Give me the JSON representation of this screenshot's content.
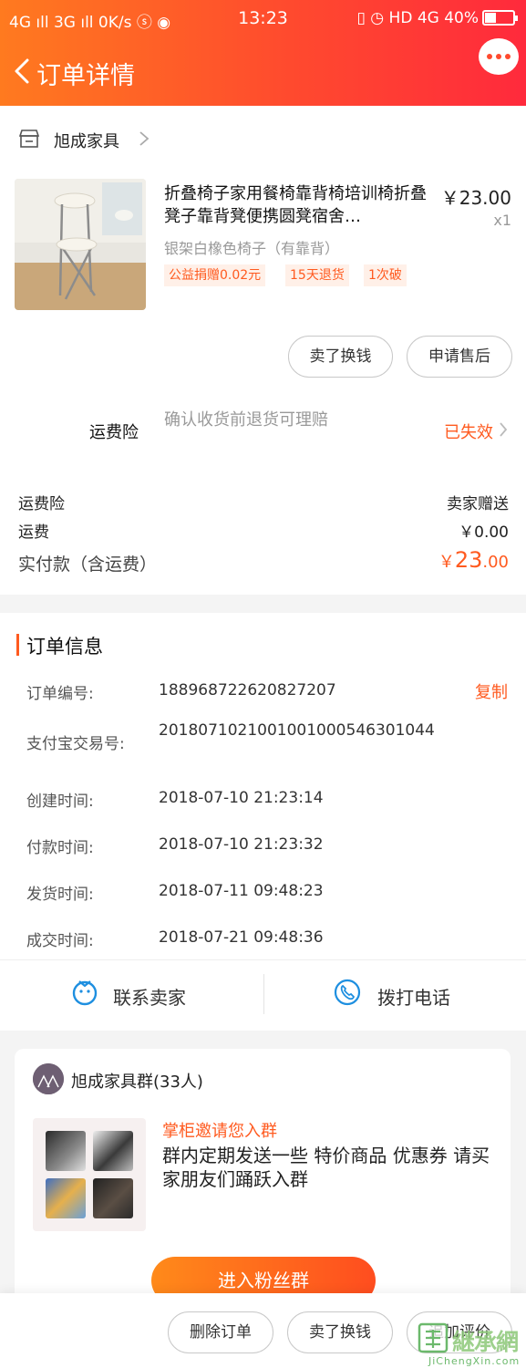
{
  "status_bar": {
    "left": "4G ıll 3G ıll 0K/s ⓢ ◉",
    "time": "13:23",
    "right": "▯ ◷ HD 4G 40%",
    "battery_percent": 40
  },
  "header": {
    "title": "订单详情"
  },
  "shop": {
    "name": "旭成家具"
  },
  "item": {
    "title": "折叠椅子家用餐椅靠背椅培训椅折叠凳子靠背凳便携圆凳宿舍…",
    "price": "￥23.00",
    "quantity": "x1",
    "spec": "银架白橡色椅子（有靠背）",
    "tags": [
      "公益捐赠0.02元",
      "15天退货",
      "1次破"
    ],
    "buttons": {
      "sell": "卖了换钱",
      "after_sale": "申请售后"
    }
  },
  "insurance": {
    "label": "运费险",
    "desc": "确认收货前退货可理赔",
    "status": "已失效"
  },
  "fees": {
    "insurance_label": "运费险",
    "insurance_value": "卖家赠送",
    "shipping_label": "运费",
    "shipping_value": "￥0.00",
    "paid_label": "实付款（含运费）",
    "paid_currency": "￥",
    "paid_int": "23",
    "paid_dec": ".00"
  },
  "order_info": {
    "title": "订单信息",
    "copy_label": "复制",
    "rows": [
      {
        "label": "订单编号:",
        "value": "188968722620827207"
      },
      {
        "label": "支付宝交易号:",
        "value": "2018071021001001000546301044"
      },
      {
        "label": "创建时间:",
        "value": "2018-07-10 21:23:14"
      },
      {
        "label": "付款时间:",
        "value": "2018-07-10 21:23:32"
      },
      {
        "label": "发货时间:",
        "value": "2018-07-11 09:48:23"
      },
      {
        "label": "成交时间:",
        "value": "2018-07-21 09:48:36"
      }
    ]
  },
  "contact": {
    "seller": "联系卖家",
    "phone": "拨打电话"
  },
  "group": {
    "name": "旭成家具群(33人)",
    "invite_title": "掌柜邀请您入群",
    "invite_desc": "群内定期发送一些 特价商品 优惠券 请买家朋友们踊跃入群",
    "join_label": "进入粉丝群"
  },
  "bottom": {
    "delete": "删除订单",
    "sell": "卖了换钱",
    "review": "追加评价"
  },
  "watermark": {
    "brand": "継承網",
    "domain": "JiChengXin.com"
  },
  "colors": {
    "accent": "#ff5a1f",
    "header_start": "#ff7a1f",
    "header_end": "#ff2a3c"
  }
}
